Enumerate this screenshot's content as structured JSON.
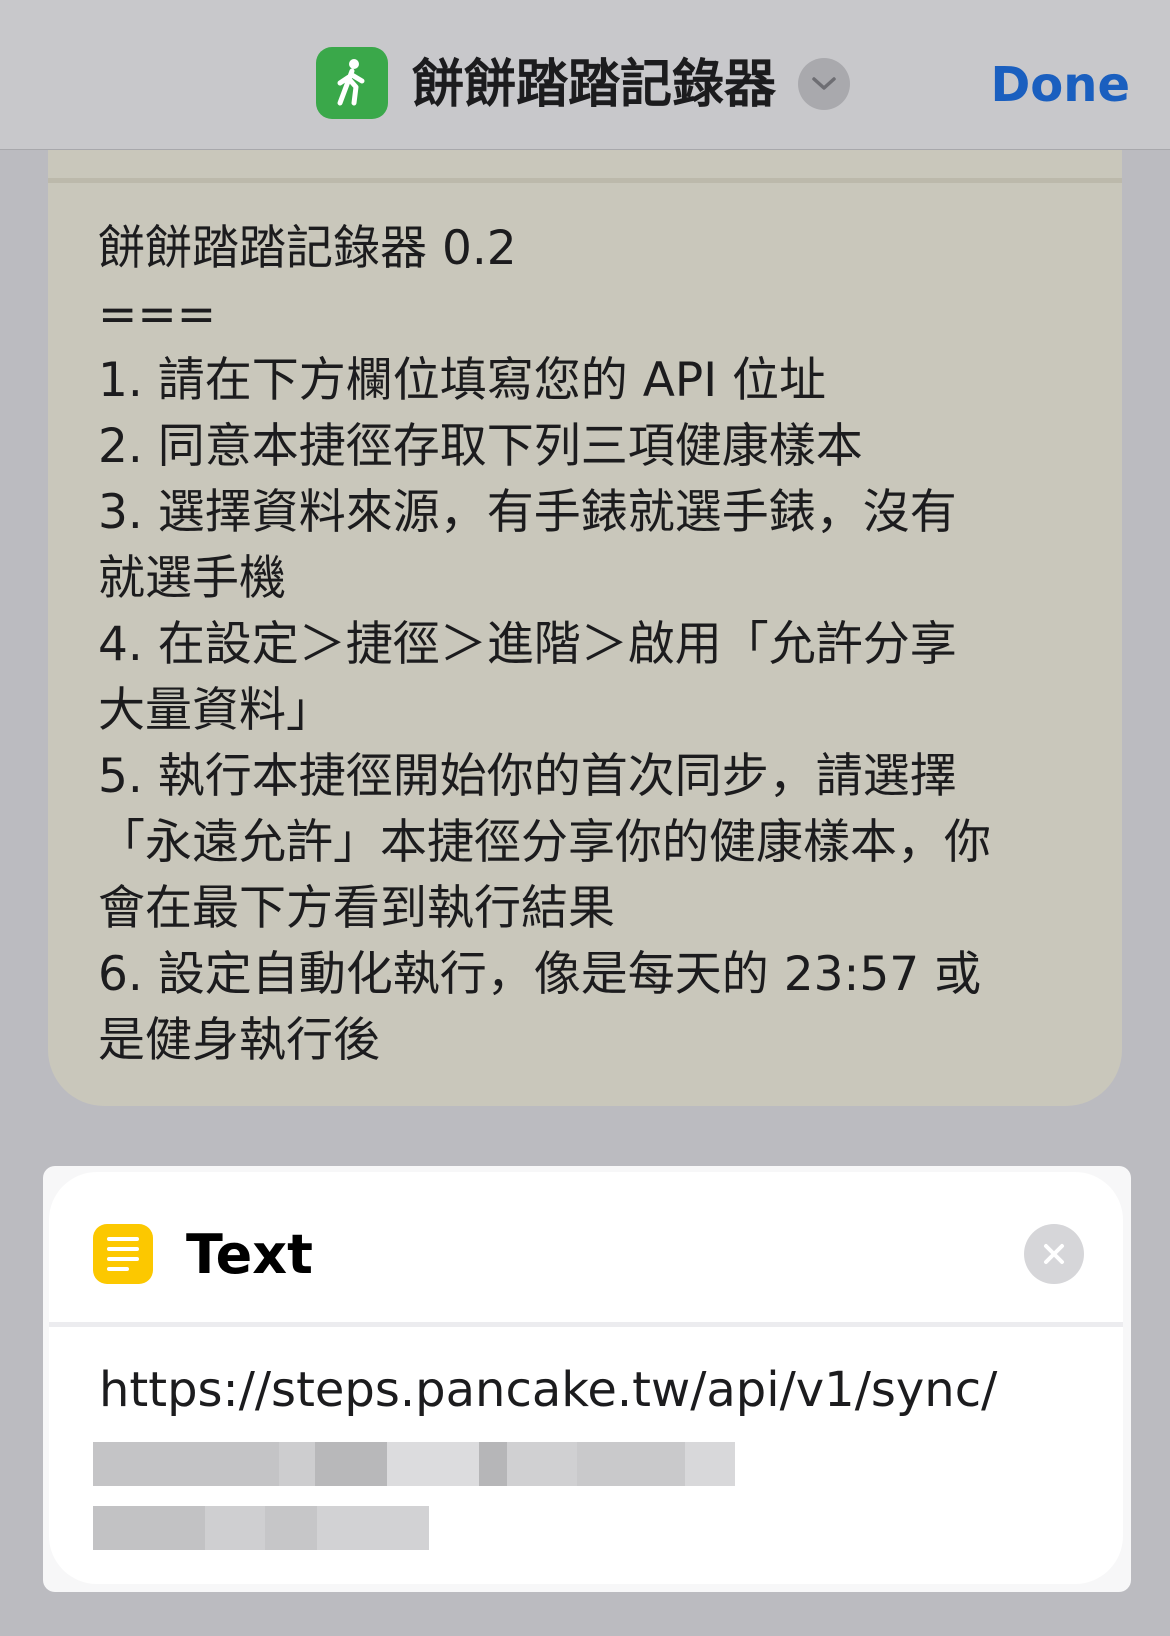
{
  "nav": {
    "title": "餅餅踏踏記錄器",
    "done_label": "Done",
    "app_icon": "walking-figure-icon",
    "app_icon_color": "#3aa84a"
  },
  "comment": {
    "lines": [
      "餅餅踏踏記錄器 0.2",
      "===",
      "1. 請在下方欄位填寫您的 API 位址",
      "2. 同意本捷徑存取下列三項健康樣本",
      "3. 選擇資料來源，有手錶就選手錶，沒有",
      "就選手機",
      "4. 在設定＞捷徑＞進階＞啟用「允許分享",
      "大量資料」",
      "5. 執行本捷徑開始你的首次同步，請選擇",
      "「永遠允許」本捷徑分享你的健康樣本，你",
      "會在最下方看到執行結果",
      "6. 設定自動化執行，像是每天的 23:57 或",
      "是健身執行後"
    ]
  },
  "action": {
    "title": "Text",
    "icon": "text-lines-icon",
    "icon_color": "#fcc800",
    "value": "https://steps.pancake.tw/api/v1/sync/"
  },
  "colors": {
    "background": "#bbbbc0",
    "done_blue": "#1a5fbf",
    "comment_card": "#c9c7bb"
  }
}
